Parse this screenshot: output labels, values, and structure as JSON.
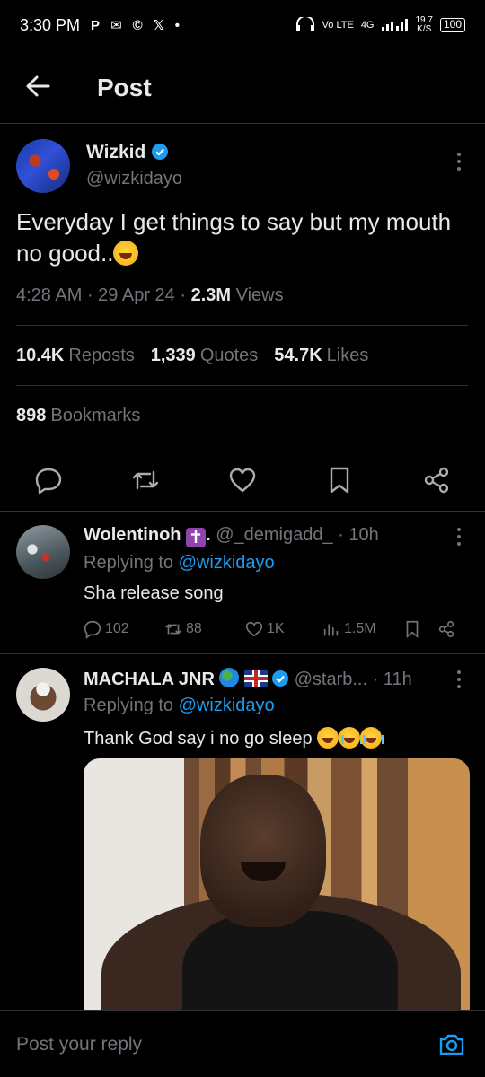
{
  "status_bar": {
    "time": "3:30 PM",
    "notification_icons": [
      "P",
      "✉",
      "©",
      "𝕏",
      "•"
    ],
    "network": "Vo LTE",
    "network_type": "4G",
    "speed": "19.7",
    "speed_unit": "K/S",
    "battery": "100"
  },
  "header": {
    "title": "Post"
  },
  "tweet": {
    "author_name": "Wizkid",
    "author_handle": "@wizkidayo",
    "text": "Everyday I get things to say but my mouth no good..",
    "time": "4:28 AM",
    "date": "29 Apr 24",
    "views_count": "2.3M",
    "views_label": "Views",
    "reposts_count": "10.4K",
    "reposts_label": "Reposts",
    "quotes_count": "1,339",
    "quotes_label": "Quotes",
    "likes_count": "54.7K",
    "likes_label": "Likes",
    "bookmarks_count": "898",
    "bookmarks_label": "Bookmarks"
  },
  "replies": [
    {
      "name": "Wolentinoh",
      "name_suffix": ".",
      "handle": "@_demigadd_",
      "time": "· 10h",
      "replying_label": "Replying to",
      "replying_to": "@wizkidayo",
      "text": "Sha release song",
      "replies": "102",
      "reposts": "88",
      "likes": "1K",
      "views": "1.5M"
    },
    {
      "name": "MACHALA JNR",
      "handle": "@starb...",
      "time": "· 11h",
      "replying_label": "Replying to",
      "replying_to": "@wizkidayo",
      "text": "Thank God say i no go sleep"
    }
  ],
  "compose": {
    "placeholder": "Post your reply"
  },
  "colors": {
    "accent": "#1d9bf0",
    "background": "#000000",
    "muted": "#71767b",
    "text": "#e7e9ea"
  }
}
